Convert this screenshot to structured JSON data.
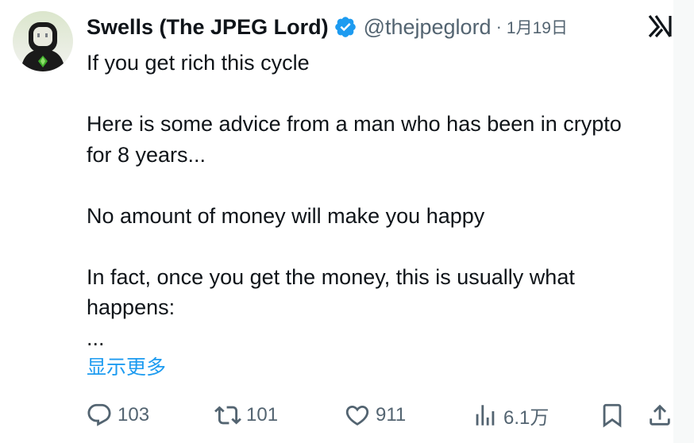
{
  "tweet": {
    "author": {
      "display_name": "Swells (The JPEG Lord)",
      "handle": "@thejpeglord",
      "verified": true
    },
    "separator": "·",
    "date": "1月19日",
    "body_lines": [
      "If you get rich this cycle",
      "",
      "Here is some advice from a man who has been in crypto",
      "for 8 years...",
      "",
      "No amount of money will make you happy",
      "",
      "In fact, once you get the money, this is usually what",
      "happens:",
      "..."
    ],
    "show_more_label": "显示更多",
    "metrics": {
      "replies": "103",
      "retweets": "101",
      "likes": "911",
      "views": "6.1万"
    }
  },
  "colors": {
    "text_primary": "#0f1419",
    "text_secondary": "#536471",
    "link": "#1d9bf0",
    "verified_badge": "#1d9bf0"
  },
  "icons": {
    "reply": "speech-bubble-icon",
    "retweet": "retweet-arrows-icon",
    "like": "heart-icon",
    "views": "bar-chart-icon",
    "bookmark": "bookmark-icon",
    "share": "share-upload-icon",
    "grok": "grok-icon",
    "verified": "verified-badge-icon"
  }
}
